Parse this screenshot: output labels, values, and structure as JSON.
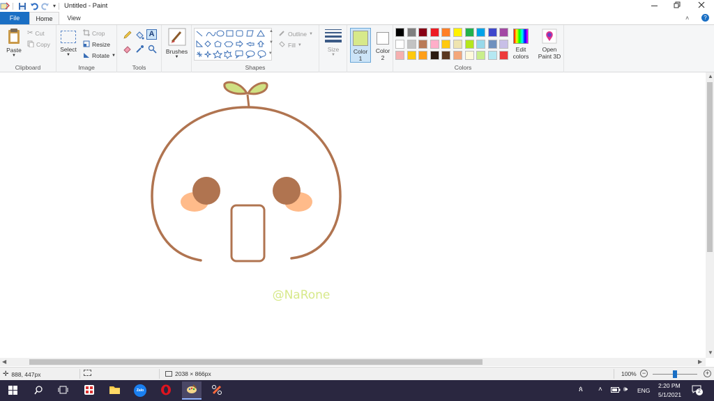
{
  "window": {
    "title": "Untitled - Paint"
  },
  "tabs": [
    "File",
    "Home",
    "View"
  ],
  "ribbon": {
    "clipboard": {
      "label": "Clipboard",
      "paste": "Paste",
      "cut": "Cut",
      "copy": "Copy"
    },
    "image": {
      "label": "Image",
      "select": "Select",
      "crop": "Crop",
      "resize": "Resize",
      "rotate": "Rotate"
    },
    "tools": {
      "label": "Tools"
    },
    "brushes": {
      "label": "Brushes"
    },
    "shapes": {
      "label": "Shapes",
      "outline": "Outline",
      "fill": "Fill"
    },
    "size": {
      "label": "Size"
    },
    "color1": {
      "label": "Color",
      "num": "1",
      "color": "#d7e98a"
    },
    "color2": {
      "label": "Color",
      "num": "2",
      "color": "#ffffff"
    },
    "colors": {
      "label": "Colors",
      "row1": [
        "#000000",
        "#7f7f7f",
        "#880015",
        "#ed1c24",
        "#ff7f27",
        "#fff200",
        "#22b14c",
        "#00a2e8",
        "#3f48cc",
        "#a349a4"
      ],
      "row2": [
        "#ffffff",
        "#c3c3c3",
        "#b97a57",
        "#ffaec9",
        "#ffc90e",
        "#efe4b0",
        "#b5e61d",
        "#99d9ea",
        "#7092be",
        "#c8bfe7"
      ],
      "row3": [
        "#f5b0b0",
        "#ffc90e",
        "#ff9f1a",
        "#2b1a10",
        "#5a3820",
        "#f4a77a",
        "#fff9dc",
        "#c9ee8c",
        "#b5e8f2",
        "#ed3b3b"
      ]
    },
    "edit_colors": {
      "line1": "Edit",
      "line2": "colors"
    },
    "paint3d": {
      "line1": "Open",
      "line2": "Paint 3D"
    }
  },
  "drawing": {
    "signature": "@NaRone",
    "outline_color": "#b07450",
    "leaf_color": "#cfe083",
    "eye_color": "#b07450",
    "blush_color": "#ffbb8a",
    "signature_color": "#d7e98a"
  },
  "status": {
    "cursor_pos": "888, 447px",
    "canvas_size": "2038 × 866px",
    "zoom": "100%",
    "zoom_level_percent": 100
  },
  "taskbar": {
    "time": "2:20 PM",
    "date": "5/1/2021",
    "lang": "ENG",
    "notifications": "2"
  }
}
